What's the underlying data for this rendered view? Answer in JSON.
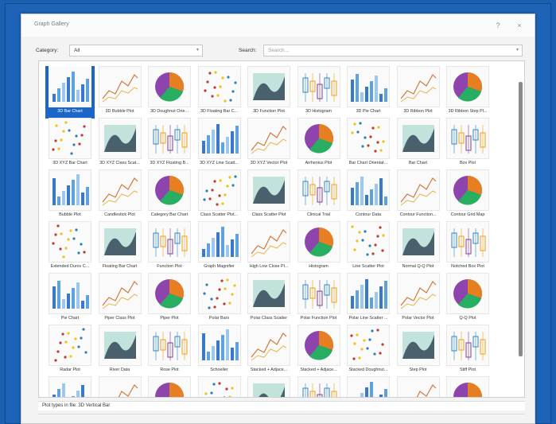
{
  "window": {
    "title": "Graph Gallery",
    "help": "?",
    "close": "×"
  },
  "toolbar": {
    "category_label": "Category:",
    "category_value": "All",
    "search_label": "Search:",
    "search_placeholder": "Search..."
  },
  "status": "Plot types in file: 3D Vertical Bar",
  "colors": {
    "selection": "#1b66c9",
    "background": "#1d64b8"
  },
  "items": [
    {
      "label": "3D Bar Chart",
      "icon": "3d-bar-chart-icon",
      "selected": true
    },
    {
      "label": "3D Bubble Plot",
      "icon": "3d-bubble-plot-icon"
    },
    {
      "label": "3D Doughnut Orie...",
      "icon": "3d-doughnut-icon"
    },
    {
      "label": "3D Floating Bar C...",
      "icon": "3d-floating-bar-icon"
    },
    {
      "label": "3D Function Plot",
      "icon": "3d-function-plot-icon"
    },
    {
      "label": "3D Histogram",
      "icon": "3d-histogram-icon"
    },
    {
      "label": "3D Pie Chart",
      "icon": "3d-pie-chart-icon"
    },
    {
      "label": "3D Ribbon Plot",
      "icon": "3d-ribbon-plot-icon"
    },
    {
      "label": "3D Ribbon Step Pl...",
      "icon": "3d-ribbon-step-icon"
    },
    {
      "label": "3D XYZ Bar Chart",
      "icon": "3d-xyz-bar-icon"
    },
    {
      "label": "3D XYZ Class Scat...",
      "icon": "3d-xyz-class-scatter-icon"
    },
    {
      "label": "3D XYZ Floating B...",
      "icon": "3d-xyz-floating-bar-icon"
    },
    {
      "label": "3D XYZ Line Scatt...",
      "icon": "3d-xyz-line-scatter-icon"
    },
    {
      "label": "3D XYZ Vector Plot",
      "icon": "3d-xyz-vector-icon"
    },
    {
      "label": "Arrhenius Plot",
      "icon": "arrhenius-plot-icon"
    },
    {
      "label": "Bar Chart Orientat...",
      "icon": "bar-chart-orientation-icon"
    },
    {
      "label": "Bar Chart",
      "icon": "bar-chart-icon"
    },
    {
      "label": "Box Plot",
      "icon": "box-plot-icon"
    },
    {
      "label": "Bubble Plot",
      "icon": "bubble-plot-icon"
    },
    {
      "label": "Candlestick Plot",
      "icon": "candlestick-plot-icon"
    },
    {
      "label": "Category Bar Chart",
      "icon": "category-bar-chart-icon"
    },
    {
      "label": "Class Scatter Plot...",
      "icon": "class-scatter-matrix-icon"
    },
    {
      "label": "Class Scatter Plot",
      "icon": "class-scatter-plot-icon"
    },
    {
      "label": "Clinical Trial",
      "icon": "clinical-trial-icon"
    },
    {
      "label": "Contour Data",
      "icon": "contour-data-icon"
    },
    {
      "label": "Contour Function...",
      "icon": "contour-function-icon"
    },
    {
      "label": "Contour Grid Map",
      "icon": "contour-grid-map-icon"
    },
    {
      "label": "Extended Durov C...",
      "icon": "extended-durov-icon"
    },
    {
      "label": "Floating Bar Chart",
      "icon": "floating-bar-chart-icon"
    },
    {
      "label": "Function Plot",
      "icon": "function-plot-icon"
    },
    {
      "label": "Graph Magnifier",
      "icon": "graph-magnifier-icon"
    },
    {
      "label": "High Low Close Pl...",
      "icon": "high-low-close-icon"
    },
    {
      "label": "Histogram",
      "icon": "histogram-icon"
    },
    {
      "label": "Line Scatter Plot",
      "icon": "line-scatter-plot-icon"
    },
    {
      "label": "Normal Q-Q Plot",
      "icon": "normal-qq-plot-icon"
    },
    {
      "label": "Notched Box Plot",
      "icon": "notched-box-plot-icon"
    },
    {
      "label": "Pie Chart",
      "icon": "pie-chart-icon"
    },
    {
      "label": "Piper Class Plot",
      "icon": "piper-class-plot-icon"
    },
    {
      "label": "Piper Plot",
      "icon": "piper-plot-icon"
    },
    {
      "label": "Polar Bars",
      "icon": "polar-bars-icon"
    },
    {
      "label": "Polar Class Scatter",
      "icon": "polar-class-scatter-icon"
    },
    {
      "label": "Polar Function Plot",
      "icon": "polar-function-plot-icon"
    },
    {
      "label": "Polar Line Scatter ...",
      "icon": "polar-line-scatter-icon"
    },
    {
      "label": "Polar Vector Plot",
      "icon": "polar-vector-plot-icon"
    },
    {
      "label": "Q-Q Plot",
      "icon": "qq-plot-icon"
    },
    {
      "label": "Radar Plot",
      "icon": "radar-plot-icon"
    },
    {
      "label": "River Data",
      "icon": "river-data-icon"
    },
    {
      "label": "Rose Plot",
      "icon": "rose-plot-icon"
    },
    {
      "label": "Schoeller",
      "icon": "schoeller-icon"
    },
    {
      "label": "Stacked + Adjace...",
      "icon": "stacked-adjacent-bar-icon"
    },
    {
      "label": "Stacked + Adjace...",
      "icon": "stacked-adjacent-area-icon"
    },
    {
      "label": "Stacked Doughnut...",
      "icon": "stacked-doughnut-icon"
    },
    {
      "label": "Step Plot",
      "icon": "step-plot-icon"
    },
    {
      "label": "Stiff Plot",
      "icon": "stiff-plot-icon"
    },
    {
      "label": "",
      "icon": "doughnut-chart-icon"
    },
    {
      "label": "",
      "icon": "3d-surface-plot-icon"
    },
    {
      "label": "",
      "icon": "3d-mesh-plot-icon"
    },
    {
      "label": "",
      "icon": "3d-heat-surface-icon"
    },
    {
      "label": "",
      "icon": "3d-terrain-plot-icon"
    },
    {
      "label": "",
      "icon": "ternary-plot-icon"
    },
    {
      "label": "",
      "icon": "ternary-scatter-icon"
    },
    {
      "label": "",
      "icon": "heatmap-grid-icon"
    },
    {
      "label": "",
      "icon": "wind-rose-icon"
    }
  ]
}
